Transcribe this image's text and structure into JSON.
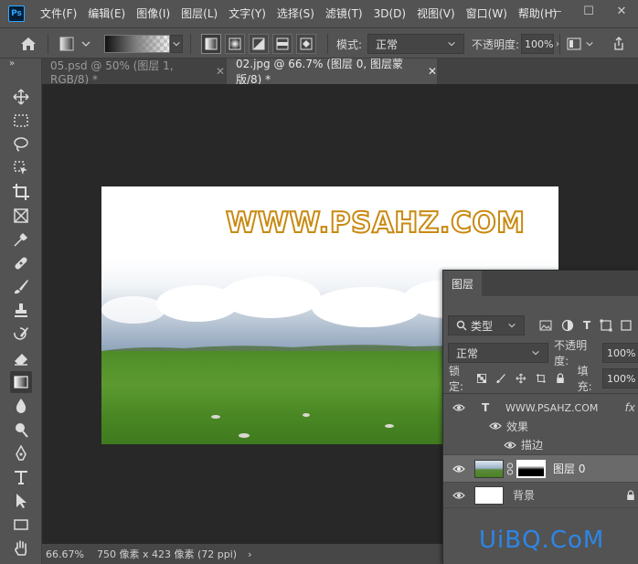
{
  "app": {
    "logo": "Ps",
    "menus": [
      "文件(F)",
      "编辑(E)",
      "图像(I)",
      "图层(L)",
      "文字(Y)",
      "选择(S)",
      "滤镜(T)",
      "3D(D)",
      "视图(V)",
      "窗口(W)",
      "帮助(H)"
    ],
    "window_controls": [
      "—",
      "☐",
      "✕"
    ]
  },
  "options": {
    "mode_label": "模式:",
    "mode_value": "正常",
    "opacity_label": "不透明度:",
    "opacity_value": "100%"
  },
  "tabs": [
    {
      "label": "05.psd @ 50% (图层 1, RGB/8) *",
      "active": false
    },
    {
      "label": "02.jpg @ 66.7% (图层 0, 图层蒙版/8) *",
      "active": true
    }
  ],
  "document": {
    "title_text": "WWW.PSAHZ.COM"
  },
  "status": {
    "zoom": "66.67%",
    "info": "750 像素 x 423 像素 (72 ppi)"
  },
  "layers_panel": {
    "title": "图层",
    "filter_label": "类型",
    "blend_mode": "正常",
    "opacity_label": "不透明度:",
    "opacity_value": "100%",
    "lock_label": "锁定:",
    "fill_label": "填充:",
    "fill_value": "100%",
    "layers": [
      {
        "name": "WWW.PSAHZ.COM",
        "type": "text",
        "fx": "fx"
      },
      {
        "name": "效果",
        "type": "effects"
      },
      {
        "name": "描边",
        "type": "effect"
      },
      {
        "name": "图层 0",
        "type": "image",
        "selected": true
      },
      {
        "name": "背景",
        "type": "background",
        "locked": true
      }
    ]
  },
  "watermark": "UiBQ.CoM",
  "colors": {
    "text_stroke": "#c98a12",
    "watermark": "#2d86e6",
    "grass": "#4e8c28"
  }
}
